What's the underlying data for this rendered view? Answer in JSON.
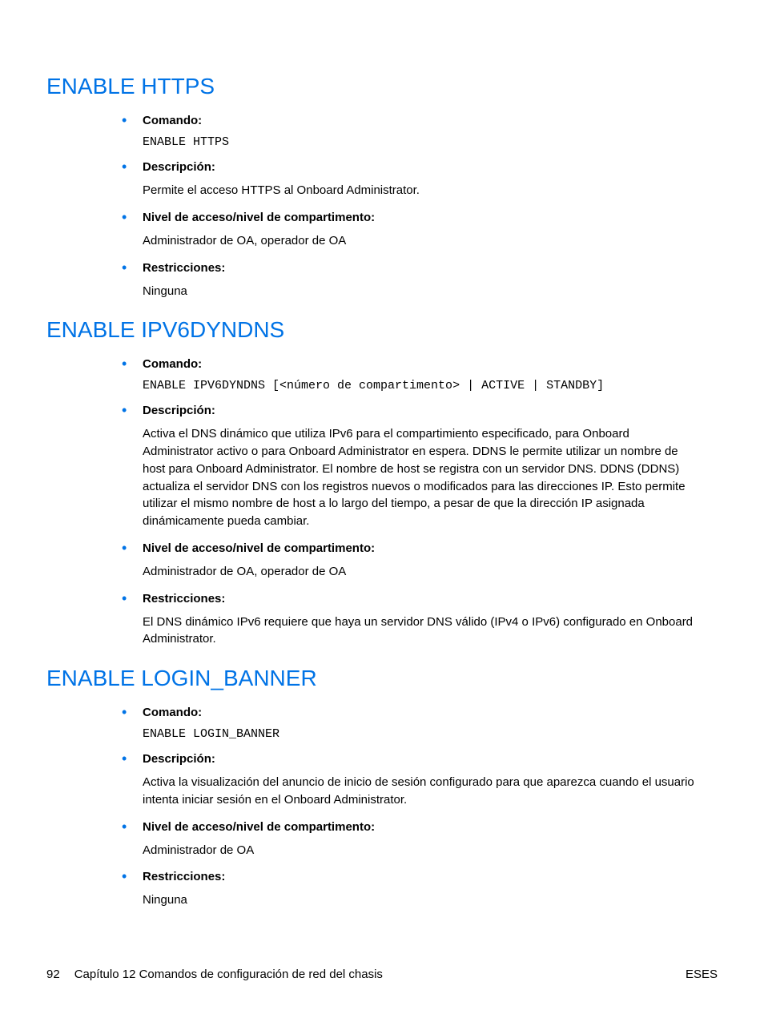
{
  "labels": {
    "comando": "Comando:",
    "descripcion": "Descripción:",
    "nivel": "Nivel de acceso/nivel de compartimento:",
    "restricciones": "Restricciones:"
  },
  "sections": [
    {
      "heading": "ENABLE HTTPS",
      "comando": "ENABLE HTTPS",
      "descripcion": "Permite el acceso HTTPS al Onboard Administrator.",
      "nivel": "Administrador de OA, operador de OA",
      "restricciones": "Ninguna"
    },
    {
      "heading": "ENABLE IPV6DYNDNS",
      "comando": "ENABLE IPV6DYNDNS [<número de compartimento> | ACTIVE | STANDBY]",
      "descripcion": "Activa el DNS dinámico que utiliza IPv6 para el compartimiento especificado, para Onboard Administrator activo o para Onboard Administrator en espera. DDNS le permite utilizar un nombre de host para Onboard Administrator. El nombre de host se registra con un servidor DNS. DDNS (DDNS) actualiza el servidor DNS con los registros nuevos o modificados para las direcciones IP. Esto permite utilizar el mismo nombre de host a lo largo del tiempo, a pesar de que la dirección IP asignada dinámicamente pueda cambiar.",
      "nivel": "Administrador de OA, operador de OA",
      "restricciones": "El DNS dinámico IPv6 requiere que haya un servidor DNS válido (IPv4 o IPv6) configurado en Onboard Administrator."
    },
    {
      "heading": "ENABLE LOGIN_BANNER",
      "comando": "ENABLE LOGIN_BANNER",
      "descripcion": "Activa la visualización del anuncio de inicio de sesión configurado para que aparezca cuando el usuario intenta iniciar sesión en el Onboard Administrator.",
      "nivel": "Administrador de OA",
      "restricciones": "Ninguna"
    }
  ],
  "footer": {
    "page": "92",
    "chapter": "Capítulo 12   Comandos de configuración de red del chasis",
    "lang": "ESES"
  }
}
